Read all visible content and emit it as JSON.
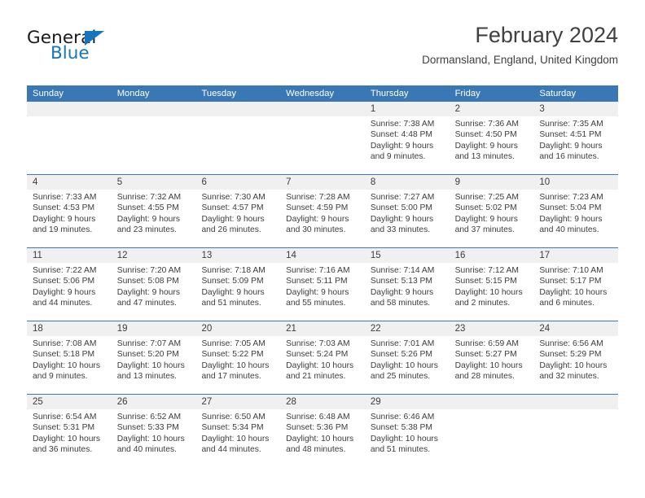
{
  "brand": {
    "name_top": "General",
    "name_bottom": "Blue",
    "triangle_icon": "triangle-icon",
    "color_dark": "#1a1a1a",
    "color_blue": "#1676bd"
  },
  "header": {
    "month_title": "February 2024",
    "location": "Dormansland, England, United Kingdom"
  },
  "colors": {
    "header_blue": "#3a77b5",
    "number_band": "#f0f0f0",
    "text": "#3c3c3c"
  },
  "calendar": {
    "weekday_headers": [
      "Sunday",
      "Monday",
      "Tuesday",
      "Wednesday",
      "Thursday",
      "Friday",
      "Saturday"
    ],
    "weeks": [
      [
        {
          "day": "",
          "sunrise": "",
          "sunset": "",
          "daylight_1": "",
          "daylight_2": "",
          "empty": true
        },
        {
          "day": "",
          "sunrise": "",
          "sunset": "",
          "daylight_1": "",
          "daylight_2": "",
          "empty": true
        },
        {
          "day": "",
          "sunrise": "",
          "sunset": "",
          "daylight_1": "",
          "daylight_2": "",
          "empty": true
        },
        {
          "day": "",
          "sunrise": "",
          "sunset": "",
          "daylight_1": "",
          "daylight_2": "",
          "empty": true
        },
        {
          "day": "1",
          "sunrise": "Sunrise: 7:38 AM",
          "sunset": "Sunset: 4:48 PM",
          "daylight_1": "Daylight: 9 hours",
          "daylight_2": "and 9 minutes.",
          "empty": false
        },
        {
          "day": "2",
          "sunrise": "Sunrise: 7:36 AM",
          "sunset": "Sunset: 4:50 PM",
          "daylight_1": "Daylight: 9 hours",
          "daylight_2": "and 13 minutes.",
          "empty": false
        },
        {
          "day": "3",
          "sunrise": "Sunrise: 7:35 AM",
          "sunset": "Sunset: 4:51 PM",
          "daylight_1": "Daylight: 9 hours",
          "daylight_2": "and 16 minutes.",
          "empty": false
        }
      ],
      [
        {
          "day": "4",
          "sunrise": "Sunrise: 7:33 AM",
          "sunset": "Sunset: 4:53 PM",
          "daylight_1": "Daylight: 9 hours",
          "daylight_2": "and 19 minutes.",
          "empty": false
        },
        {
          "day": "5",
          "sunrise": "Sunrise: 7:32 AM",
          "sunset": "Sunset: 4:55 PM",
          "daylight_1": "Daylight: 9 hours",
          "daylight_2": "and 23 minutes.",
          "empty": false
        },
        {
          "day": "6",
          "sunrise": "Sunrise: 7:30 AM",
          "sunset": "Sunset: 4:57 PM",
          "daylight_1": "Daylight: 9 hours",
          "daylight_2": "and 26 minutes.",
          "empty": false
        },
        {
          "day": "7",
          "sunrise": "Sunrise: 7:28 AM",
          "sunset": "Sunset: 4:59 PM",
          "daylight_1": "Daylight: 9 hours",
          "daylight_2": "and 30 minutes.",
          "empty": false
        },
        {
          "day": "8",
          "sunrise": "Sunrise: 7:27 AM",
          "sunset": "Sunset: 5:00 PM",
          "daylight_1": "Daylight: 9 hours",
          "daylight_2": "and 33 minutes.",
          "empty": false
        },
        {
          "day": "9",
          "sunrise": "Sunrise: 7:25 AM",
          "sunset": "Sunset: 5:02 PM",
          "daylight_1": "Daylight: 9 hours",
          "daylight_2": "and 37 minutes.",
          "empty": false
        },
        {
          "day": "10",
          "sunrise": "Sunrise: 7:23 AM",
          "sunset": "Sunset: 5:04 PM",
          "daylight_1": "Daylight: 9 hours",
          "daylight_2": "and 40 minutes.",
          "empty": false
        }
      ],
      [
        {
          "day": "11",
          "sunrise": "Sunrise: 7:22 AM",
          "sunset": "Sunset: 5:06 PM",
          "daylight_1": "Daylight: 9 hours",
          "daylight_2": "and 44 minutes.",
          "empty": false
        },
        {
          "day": "12",
          "sunrise": "Sunrise: 7:20 AM",
          "sunset": "Sunset: 5:08 PM",
          "daylight_1": "Daylight: 9 hours",
          "daylight_2": "and 47 minutes.",
          "empty": false
        },
        {
          "day": "13",
          "sunrise": "Sunrise: 7:18 AM",
          "sunset": "Sunset: 5:09 PM",
          "daylight_1": "Daylight: 9 hours",
          "daylight_2": "and 51 minutes.",
          "empty": false
        },
        {
          "day": "14",
          "sunrise": "Sunrise: 7:16 AM",
          "sunset": "Sunset: 5:11 PM",
          "daylight_1": "Daylight: 9 hours",
          "daylight_2": "and 55 minutes.",
          "empty": false
        },
        {
          "day": "15",
          "sunrise": "Sunrise: 7:14 AM",
          "sunset": "Sunset: 5:13 PM",
          "daylight_1": "Daylight: 9 hours",
          "daylight_2": "and 58 minutes.",
          "empty": false
        },
        {
          "day": "16",
          "sunrise": "Sunrise: 7:12 AM",
          "sunset": "Sunset: 5:15 PM",
          "daylight_1": "Daylight: 10 hours",
          "daylight_2": "and 2 minutes.",
          "empty": false
        },
        {
          "day": "17",
          "sunrise": "Sunrise: 7:10 AM",
          "sunset": "Sunset: 5:17 PM",
          "daylight_1": "Daylight: 10 hours",
          "daylight_2": "and 6 minutes.",
          "empty": false
        }
      ],
      [
        {
          "day": "18",
          "sunrise": "Sunrise: 7:08 AM",
          "sunset": "Sunset: 5:18 PM",
          "daylight_1": "Daylight: 10 hours",
          "daylight_2": "and 9 minutes.",
          "empty": false
        },
        {
          "day": "19",
          "sunrise": "Sunrise: 7:07 AM",
          "sunset": "Sunset: 5:20 PM",
          "daylight_1": "Daylight: 10 hours",
          "daylight_2": "and 13 minutes.",
          "empty": false
        },
        {
          "day": "20",
          "sunrise": "Sunrise: 7:05 AM",
          "sunset": "Sunset: 5:22 PM",
          "daylight_1": "Daylight: 10 hours",
          "daylight_2": "and 17 minutes.",
          "empty": false
        },
        {
          "day": "21",
          "sunrise": "Sunrise: 7:03 AM",
          "sunset": "Sunset: 5:24 PM",
          "daylight_1": "Daylight: 10 hours",
          "daylight_2": "and 21 minutes.",
          "empty": false
        },
        {
          "day": "22",
          "sunrise": "Sunrise: 7:01 AM",
          "sunset": "Sunset: 5:26 PM",
          "daylight_1": "Daylight: 10 hours",
          "daylight_2": "and 25 minutes.",
          "empty": false
        },
        {
          "day": "23",
          "sunrise": "Sunrise: 6:59 AM",
          "sunset": "Sunset: 5:27 PM",
          "daylight_1": "Daylight: 10 hours",
          "daylight_2": "and 28 minutes.",
          "empty": false
        },
        {
          "day": "24",
          "sunrise": "Sunrise: 6:56 AM",
          "sunset": "Sunset: 5:29 PM",
          "daylight_1": "Daylight: 10 hours",
          "daylight_2": "and 32 minutes.",
          "empty": false
        }
      ],
      [
        {
          "day": "25",
          "sunrise": "Sunrise: 6:54 AM",
          "sunset": "Sunset: 5:31 PM",
          "daylight_1": "Daylight: 10 hours",
          "daylight_2": "and 36 minutes.",
          "empty": false
        },
        {
          "day": "26",
          "sunrise": "Sunrise: 6:52 AM",
          "sunset": "Sunset: 5:33 PM",
          "daylight_1": "Daylight: 10 hours",
          "daylight_2": "and 40 minutes.",
          "empty": false
        },
        {
          "day": "27",
          "sunrise": "Sunrise: 6:50 AM",
          "sunset": "Sunset: 5:34 PM",
          "daylight_1": "Daylight: 10 hours",
          "daylight_2": "and 44 minutes.",
          "empty": false
        },
        {
          "day": "28",
          "sunrise": "Sunrise: 6:48 AM",
          "sunset": "Sunset: 5:36 PM",
          "daylight_1": "Daylight: 10 hours",
          "daylight_2": "and 48 minutes.",
          "empty": false
        },
        {
          "day": "29",
          "sunrise": "Sunrise: 6:46 AM",
          "sunset": "Sunset: 5:38 PM",
          "daylight_1": "Daylight: 10 hours",
          "daylight_2": "and 51 minutes.",
          "empty": false
        },
        {
          "day": "",
          "sunrise": "",
          "sunset": "",
          "daylight_1": "",
          "daylight_2": "",
          "empty": true
        },
        {
          "day": "",
          "sunrise": "",
          "sunset": "",
          "daylight_1": "",
          "daylight_2": "",
          "empty": true
        }
      ]
    ]
  }
}
